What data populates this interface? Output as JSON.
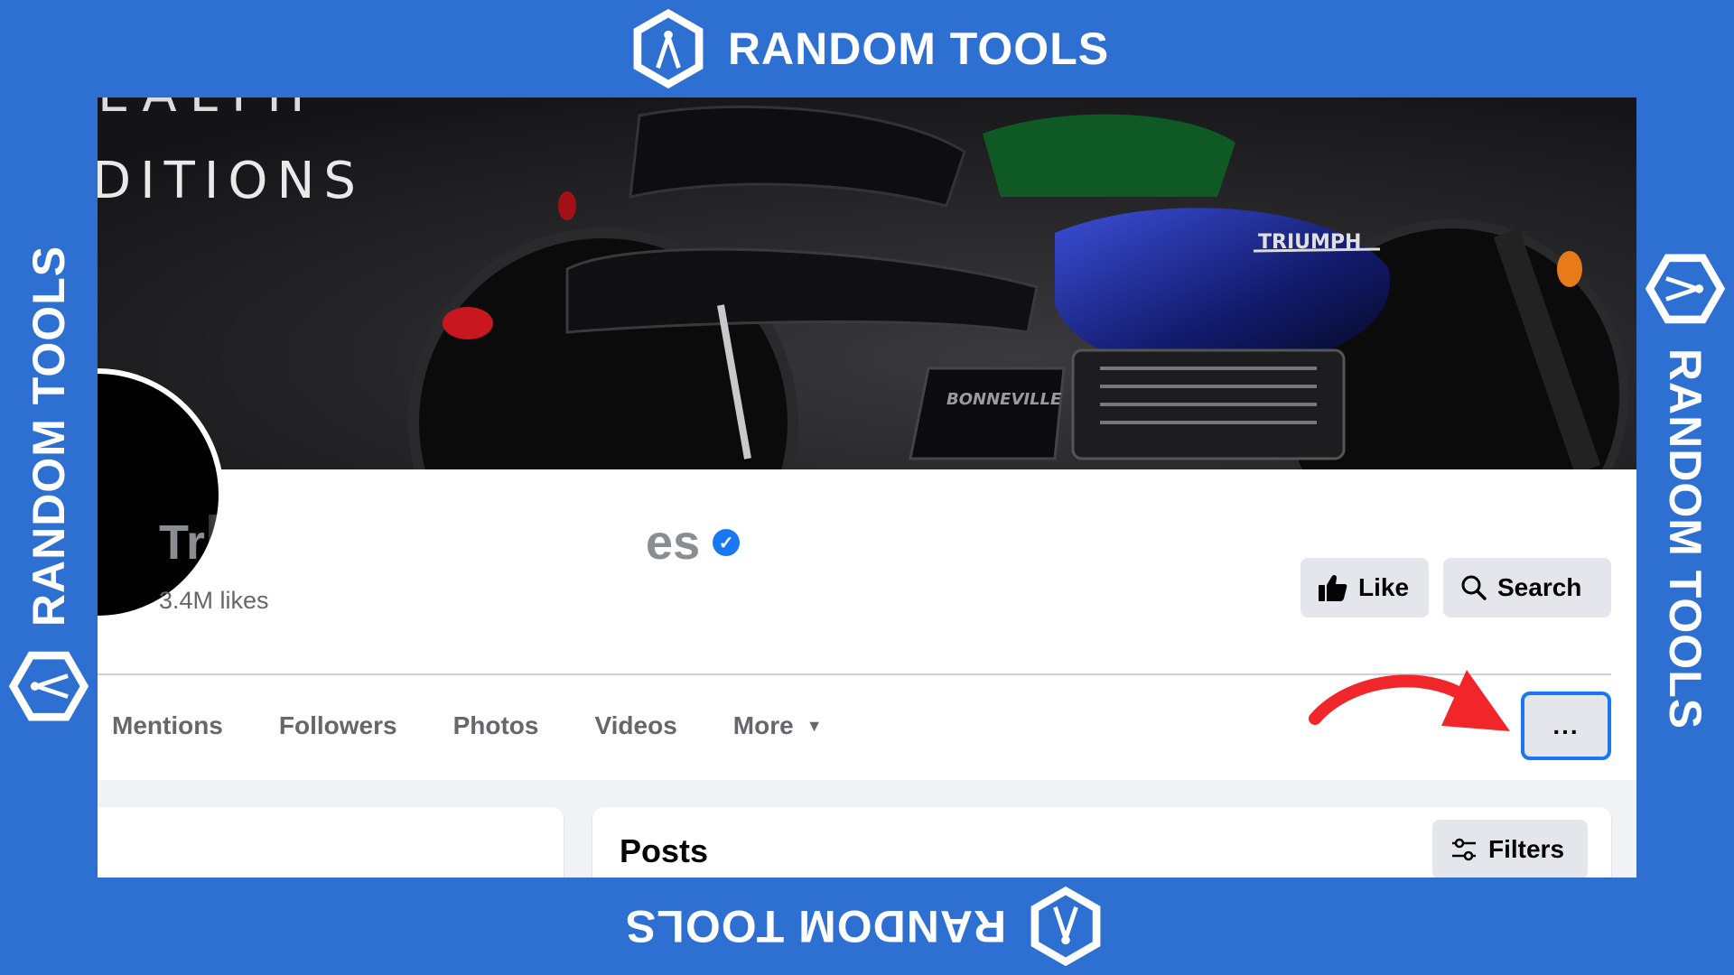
{
  "branding": {
    "text": "RANDOM TOOLS",
    "background_color": "#2e6fd2",
    "logo_icon": "compass-hexagon-icon"
  },
  "cover": {
    "text_line_1": "EALTH",
    "text_line_2": "DITIONS",
    "badge_1": "TRIUMPH",
    "badge_2": "BONNEVILLE"
  },
  "page": {
    "name_start": "Tr",
    "name_end": "es",
    "verified_icon": "verified-badge-icon",
    "likes": "3.4M likes"
  },
  "actions": {
    "like_label": "Like",
    "search_label": "Search",
    "more_label": "..."
  },
  "tabs": [
    {
      "label": "Mentions"
    },
    {
      "label": "Followers"
    },
    {
      "label": "Photos"
    },
    {
      "label": "Videos"
    },
    {
      "label": "More"
    }
  ],
  "posts": {
    "title": "Posts",
    "filters_label": "Filters"
  },
  "annotation": {
    "arrow_color": "#f0262b",
    "highlight_color": "#1877f2"
  }
}
